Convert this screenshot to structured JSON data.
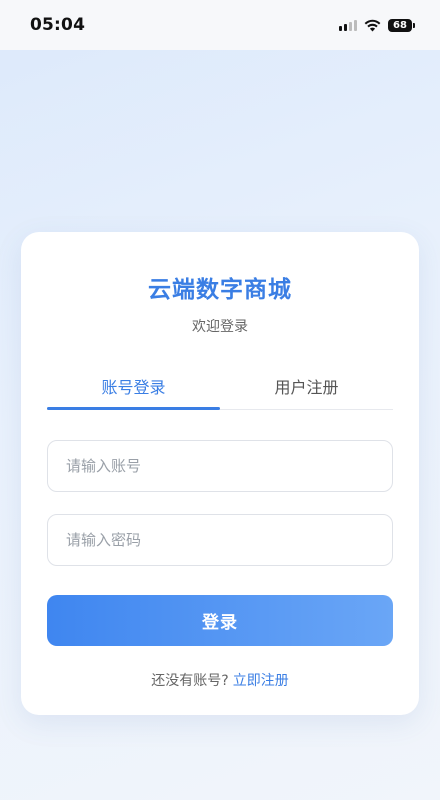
{
  "status_bar": {
    "time": "05:04",
    "battery": "68",
    "icons": [
      "signal-icon",
      "wifi-icon",
      "battery-icon"
    ]
  },
  "app": {
    "title": "云端数字商城",
    "subtitle": "欢迎登录"
  },
  "tabs": [
    {
      "label": "账号登录",
      "active": true
    },
    {
      "label": "用户注册",
      "active": false
    }
  ],
  "form": {
    "account": {
      "value": "",
      "placeholder": "请输入账号"
    },
    "password": {
      "value": "",
      "placeholder": "请输入密码"
    },
    "submit_label": "登录"
  },
  "footer": {
    "prompt": "还没有账号?",
    "register_link": "立即注册"
  },
  "colors": {
    "accent": "#3a7ee4",
    "button_gradient_start": "#3f86f0",
    "button_gradient_end": "#6aa6f6"
  }
}
